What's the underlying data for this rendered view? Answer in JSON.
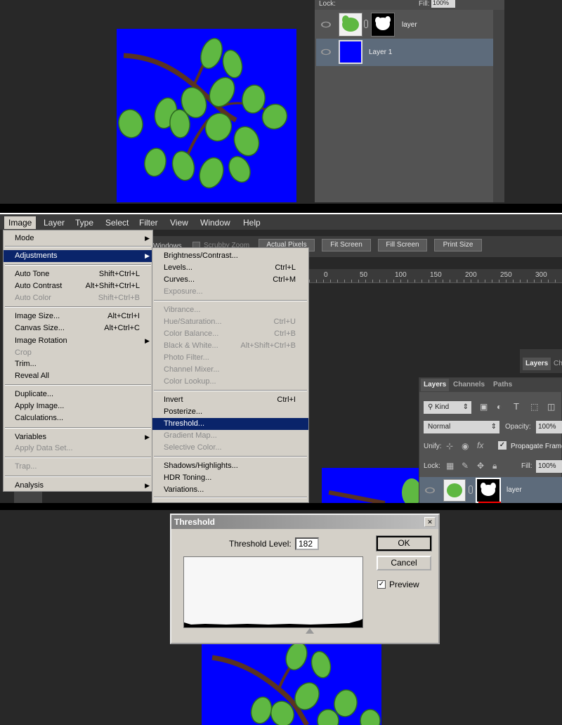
{
  "panel1": {
    "lock_label": "Lock:",
    "fill_label": "Fill:",
    "fill_value": "100%",
    "layers": [
      {
        "name": "layer"
      },
      {
        "name": "Layer 1"
      }
    ]
  },
  "menubar": [
    "Image",
    "Layer",
    "Type",
    "Select",
    "Filter",
    "View",
    "Window",
    "Help"
  ],
  "toolbar": {
    "windows_label": "Windows",
    "scrubby_zoom": "Scrubby Zoom",
    "actual_pixels": "Actual Pixels",
    "fit_screen": "Fit Screen",
    "fill_screen": "Fill Screen",
    "print_size": "Print Size"
  },
  "ruler": [
    "0",
    "50",
    "100",
    "150",
    "200",
    "250",
    "300"
  ],
  "image_menu": [
    {
      "label": "Mode",
      "arrow": "▶"
    },
    {
      "label": "Adjustments",
      "arrow": "▶",
      "selected": true
    },
    {
      "label": "Auto Tone",
      "shortcut": "Shift+Ctrl+L"
    },
    {
      "label": "Auto Contrast",
      "shortcut": "Alt+Shift+Ctrl+L"
    },
    {
      "label": "Auto Color",
      "shortcut": "Shift+Ctrl+B",
      "disabled": true
    },
    {
      "label": "Image Size...",
      "shortcut": "Alt+Ctrl+I"
    },
    {
      "label": "Canvas Size...",
      "shortcut": "Alt+Ctrl+C"
    },
    {
      "label": "Image Rotation",
      "arrow": "▶"
    },
    {
      "label": "Crop",
      "disabled": true
    },
    {
      "label": "Trim..."
    },
    {
      "label": "Reveal All"
    },
    {
      "label": "Duplicate..."
    },
    {
      "label": "Apply Image..."
    },
    {
      "label": "Calculations..."
    },
    {
      "label": "Variables",
      "arrow": "▶"
    },
    {
      "label": "Apply Data Set...",
      "disabled": true
    },
    {
      "label": "Trap...",
      "disabled": true
    },
    {
      "label": "Analysis",
      "arrow": "▶"
    }
  ],
  "adjust_menu": [
    {
      "label": "Brightness/Contrast..."
    },
    {
      "label": "Levels...",
      "shortcut": "Ctrl+L"
    },
    {
      "label": "Curves...",
      "shortcut": "Ctrl+M"
    },
    {
      "label": "Exposure...",
      "disabled": true
    },
    {
      "label": "Vibrance...",
      "disabled": true
    },
    {
      "label": "Hue/Saturation...",
      "shortcut": "Ctrl+U",
      "disabled": true
    },
    {
      "label": "Color Balance...",
      "shortcut": "Ctrl+B",
      "disabled": true
    },
    {
      "label": "Black & White...",
      "shortcut": "Alt+Shift+Ctrl+B",
      "disabled": true
    },
    {
      "label": "Photo Filter...",
      "disabled": true
    },
    {
      "label": "Channel Mixer...",
      "disabled": true
    },
    {
      "label": "Color Lookup...",
      "disabled": true
    },
    {
      "label": "Invert",
      "shortcut": "Ctrl+I"
    },
    {
      "label": "Posterize..."
    },
    {
      "label": "Threshold...",
      "selected": true
    },
    {
      "label": "Gradient Map...",
      "disabled": true
    },
    {
      "label": "Selective Color...",
      "disabled": true
    },
    {
      "label": "Shadows/Highlights..."
    },
    {
      "label": "HDR Toning..."
    },
    {
      "label": "Variations..."
    }
  ],
  "layers_panel": {
    "back_tabs": [
      "Layers",
      "Ch"
    ],
    "tabs": [
      "Layers",
      "Channels",
      "Paths"
    ],
    "kind": "Kind",
    "blend_mode": "Normal",
    "opacity_label": "Opacity:",
    "opacity_value": "100%",
    "unify_label": "Unify:",
    "propagate_label": "Propagate Frame",
    "lock_label": "Lock:",
    "fill_label": "Fill:",
    "fill_value": "100%",
    "layer_name": "layer"
  },
  "threshold_dialog": {
    "title": "Threshold",
    "close": "✕",
    "level_label": "Threshold Level:",
    "level_value": "182",
    "ok": "OK",
    "cancel": "Cancel",
    "preview_label": "Preview",
    "preview_checked": true
  },
  "colors": {
    "canvas_blue": "#0000ff",
    "menu_bg": "#d4d0c8",
    "menu_selected": "#0a246a",
    "leaf_green": "#4caf3a",
    "branch_brown": "#5a3320"
  }
}
